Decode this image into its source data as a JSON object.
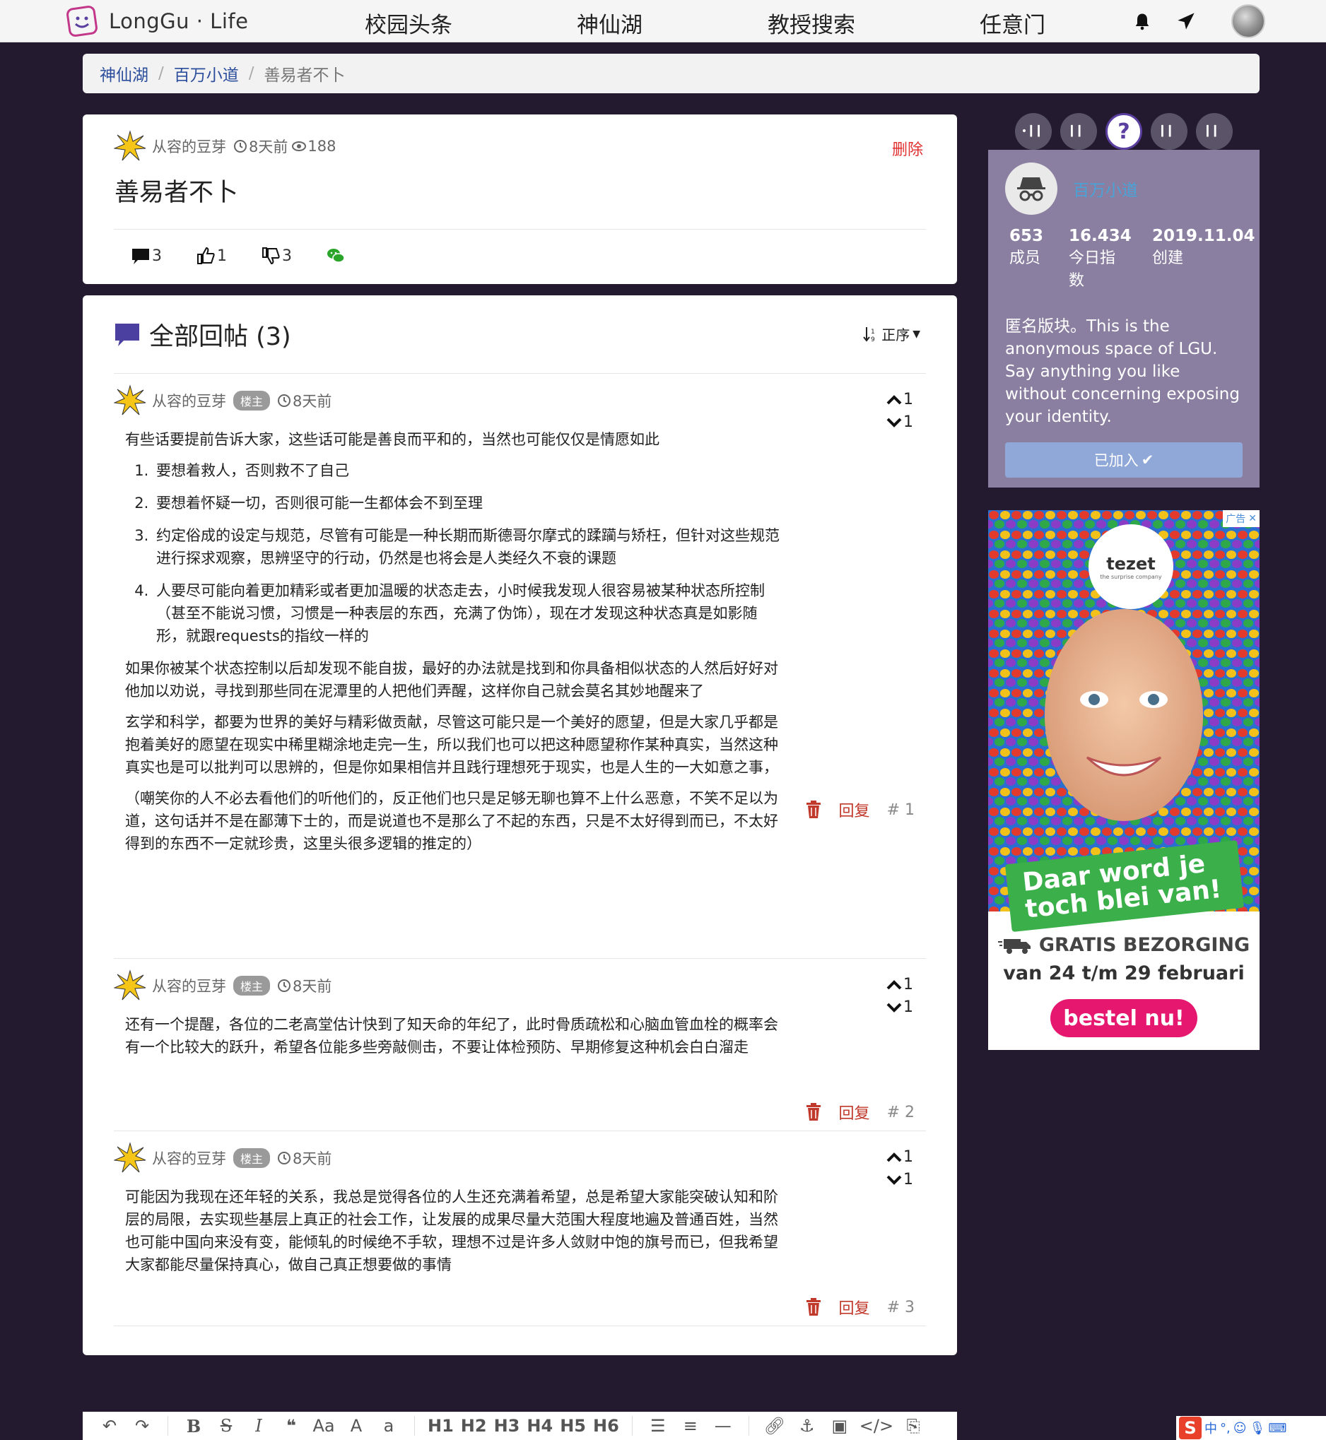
{
  "navbar": {
    "brand": "LongGu · Life",
    "links": [
      "校园头条",
      "神仙湖",
      "教授搜索",
      "任意门"
    ]
  },
  "breadcrumb": {
    "items": [
      "神仙湖",
      "百万小道"
    ],
    "current": "善易者不卜"
  },
  "post": {
    "author": "从容的豆芽",
    "time": "8天前",
    "views": "188",
    "delete_label": "删除",
    "title": "善易者不卜",
    "comments": "3",
    "likes": "1",
    "dislikes": "3"
  },
  "replies_section": {
    "title": "全部回帖 (3)",
    "sort_label": "正序"
  },
  "replies": [
    {
      "author": "从容的豆芽",
      "badge": "楼主",
      "time": "8天前",
      "up": "1",
      "down": "1",
      "intro": "有些话要提前告诉大家，这些话可能是善良而平和的，当然也可能仅仅是情愿如此",
      "list": [
        "要想着救人，否则救不了自己",
        "要想着怀疑一切，否则很可能一生都体会不到至理",
        "约定俗成的设定与规范，尽管有可能是一种长期而斯德哥尔摩式的蹂躏与矫枉，但针对这些规范进行探求观察，思辨坚守的行动，仍然是也将会是人类经久不衰的课题",
        "人要尽可能向着更加精彩或者更加温暖的状态走去，小时候我发现人很容易被某种状态所控制（甚至不能说习惯，习惯是一种表层的东西，充满了伪饰），现在才发现这种状态真是如影随形，就跟requests的指纹一样的"
      ],
      "p1": "如果你被某个状态控制以后却发现不能自拔，最好的办法就是找到和你具备相似状态的人然后好好对他加以劝说，寻找到那些同在泥潭里的人把他们弄醒，这样你自己就会莫名其妙地醒来了",
      "p2": "玄学和科学，都要为世界的美好与精彩做贡献，尽管这可能只是一个美好的愿望，但是大家几乎都是抱着美好的愿望在现实中稀里糊涂地走完一生，所以我们也可以把这种愿望称作某种真实，当然这种真实也是可以批判可以思辨的，但是你如果相信并且践行理想死于现实，也是人生的一大如意之事，",
      "p3": "（嘲笑你的人不必去看他们的听他们的，反正他们也只是足够无聊也算不上什么恶意，不笑不足以为道，这句话并不是在鄙薄下士的，而是说道也不是那么了不起的东西，只是不太好得到而已，不太好得到的东西不一定就珍贵，这里头很多逻辑的推定的）",
      "reply_label": "回复",
      "floor": "# 1"
    },
    {
      "author": "从容的豆芽",
      "badge": "楼主",
      "time": "8天前",
      "up": "1",
      "down": "1",
      "text": "还有一个提醒，各位的二老高堂估计快到了知天命的年纪了，此时骨质疏松和心脑血管血栓的概率会有一个比较大的跃升，希望各位能多些旁敲侧击，不要让体检预防、早期修复这种机会白白溜走",
      "reply_label": "回复",
      "floor": "# 2"
    },
    {
      "author": "从容的豆芽",
      "badge": "楼主",
      "time": "8天前",
      "up": "1",
      "down": "1",
      "text": "可能因为我现在还年轻的关系，我总是觉得各位的人生还充满着希望，总是希望大家能突破认知和阶层的局限，去实现些基层上真正的社会工作，让发展的成果尽量大范围大程度地遍及普通百姓，当然也可能中国向来没有变，能倾轧的时候绝不手软，理想不过是许多人敛财中饱的旗号而已，但我希望大家都能尽量保持真心，做自己真正想要做的事情",
      "reply_label": "回复",
      "floor": "# 3"
    }
  ],
  "sidebar": {
    "emoji_active": "?",
    "board_name": "百万小道",
    "stats": [
      {
        "num": "653",
        "label": "成员"
      },
      {
        "num": "16.434",
        "label": "今日指数"
      },
      {
        "num": "2019.11.04",
        "label": "创建"
      }
    ],
    "description": "匿名版块。This is the anonymous space of LGU. Say anything you like without concerning exposing your identity.",
    "joined_label": "已加入"
  },
  "ad": {
    "tag": "广告",
    "brand": "tezet",
    "brand_sub": "the surprise company",
    "banner": "Daar word je toch blei van!",
    "shipping": "GRATIS BEZORGING",
    "dates": "van 24 t/m 29 februari",
    "cta": "bestel nu!"
  },
  "editor_toolbar": {
    "headings": [
      "H1",
      "H2",
      "H3",
      "H4",
      "H5",
      "H6"
    ],
    "font_label": "Aa"
  },
  "ime": {
    "logo": "S",
    "lang": "中"
  },
  "colors": {
    "background": "#231a30",
    "board_card": "#8a7fa0",
    "delete": "#e03030",
    "ad_cta": "#e6176e"
  }
}
